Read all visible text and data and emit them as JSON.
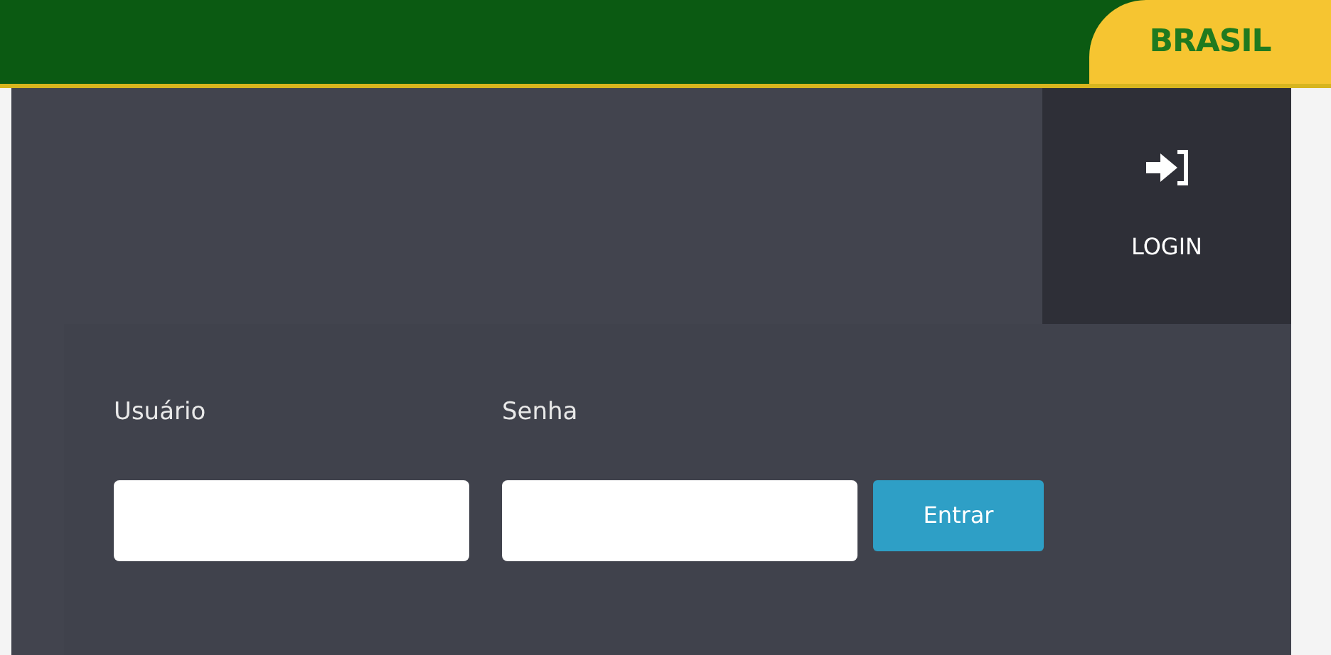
{
  "header": {
    "brand": "BRASIL"
  },
  "login_menu": {
    "label": "LOGIN"
  },
  "form": {
    "fields": [
      {
        "label": "Usuário"
      },
      {
        "label": "Senha"
      }
    ],
    "submit": "Entrar"
  }
}
